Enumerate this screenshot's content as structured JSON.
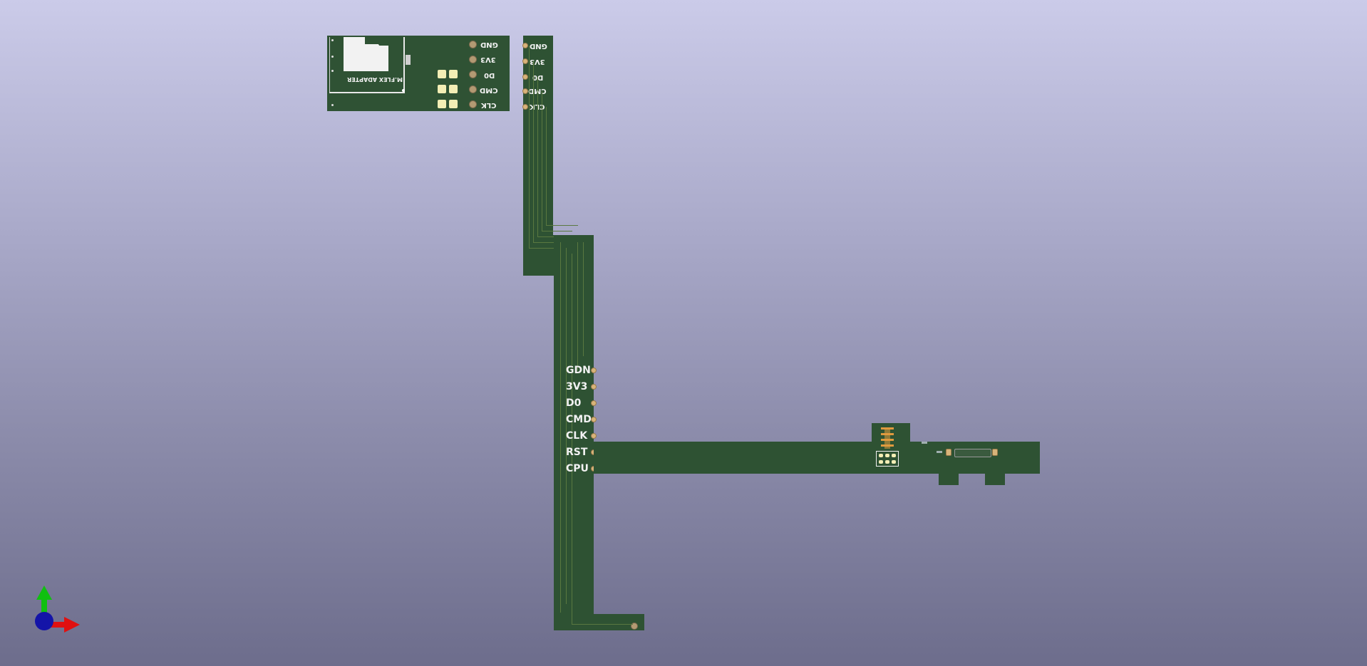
{
  "adapter_board": {
    "silk_title": "M.FLEX ADAPTER",
    "pins": [
      "GND",
      "3V3",
      "D0",
      "CMD",
      "CLK"
    ]
  },
  "flex_strip_top": {
    "pins": [
      "GND",
      "3V3",
      "D0",
      "CMD",
      "CLK"
    ]
  },
  "main_strip": {
    "pins": [
      "GDN",
      "3V3",
      "D0",
      "CMD",
      "CLK",
      "RST",
      "CPU"
    ]
  },
  "colors": {
    "board": "#2e5233",
    "silkscreen": "#f2f2f2",
    "copper_pad": "#d8b47a",
    "axis_x": "#e01010",
    "axis_y": "#10c010",
    "axis_z": "#1010a0"
  },
  "icons": {
    "axis_indicator": "xyz-axis-icon"
  }
}
